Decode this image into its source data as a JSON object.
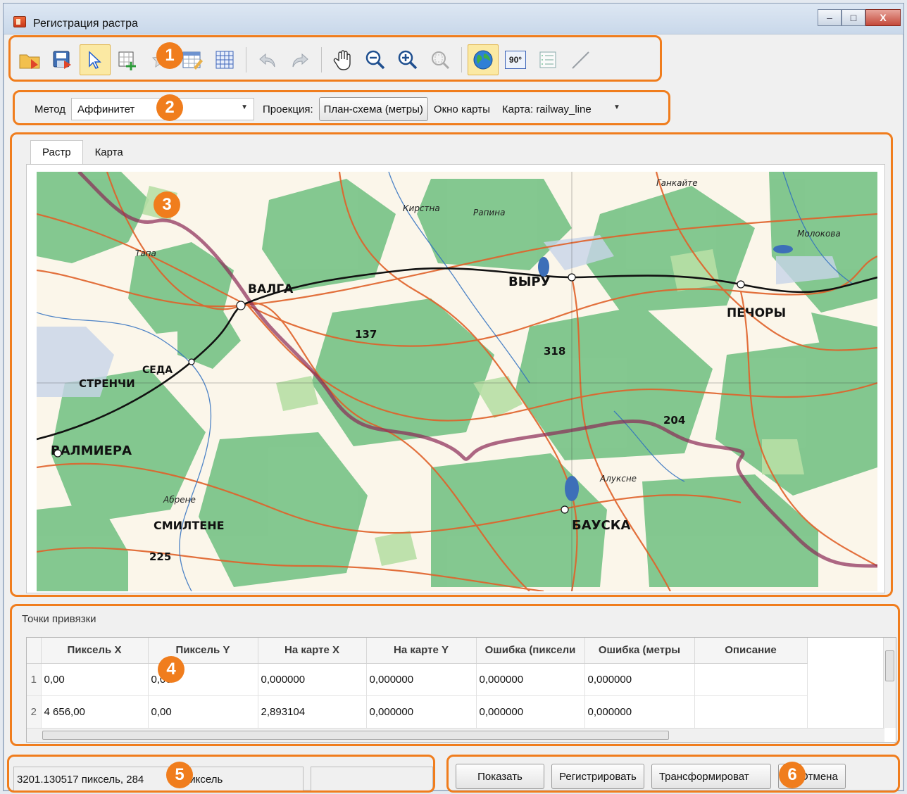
{
  "window": {
    "title": "Регистрация растра",
    "minimize": "‒",
    "maximize": "□",
    "close": "X"
  },
  "toolbar": {
    "items": [
      "open",
      "save",
      "select",
      "add-point",
      "delete-point",
      "table",
      "grid",
      "undo",
      "redo",
      "pan",
      "zoom-out",
      "zoom-in",
      "zoom-extent",
      "globe",
      "rotate-90",
      "list",
      "line"
    ],
    "rotate_label": "90°"
  },
  "params": {
    "method_label": "Метод",
    "method_value": "Аффинитет",
    "projection_label": "Проекция:",
    "projection_value": "План-схема (метры)",
    "map_window_label": "Окно карты",
    "map_window_value": "Карта: railway_line"
  },
  "tabs": [
    {
      "label": "Растр",
      "active": true
    },
    {
      "label": "Карта",
      "active": false
    }
  ],
  "map_labels": [
    "ВАЛГА",
    "ВЫРУ",
    "ПЕЧОРЫ",
    "ВАЛМИЕРА",
    "СМИЛТЕНЕ",
    "БАУСКА",
    "СТРЕНЧИ",
    "СЕДА",
    "Молокова",
    "Абрене",
    "Алуксне",
    "Тапа",
    "Ганкайте",
    "Рапина",
    "Кирстна",
    "318",
    "204",
    "225",
    "137"
  ],
  "points": {
    "title": "Точки привязки",
    "columns": [
      "Пиксель X",
      "Пиксель Y",
      "На карте X",
      "На карте Y",
      "Ошибка (пиксели",
      "Ошибка (метры",
      "Описание"
    ],
    "rows": [
      {
        "n": "1",
        "px": "0,00",
        "py": "0,00",
        "mx": "0,000000",
        "my": "0,000000",
        "ep": "0,000000",
        "em": "0,000000",
        "desc": ""
      },
      {
        "n": "2",
        "px": "4 656,00",
        "py": "0,00",
        "mx": "2,893104",
        "my": "0,000000",
        "ep": "0,000000",
        "em": "0,000000",
        "desc": ""
      }
    ]
  },
  "status": {
    "coords": "3201.130517 пиксель, 284",
    "coords_tail": "96 пиксель",
    "extra": ""
  },
  "actions": {
    "show": "Показать",
    "register": "Регистрировать",
    "transform": "Трансформироват",
    "cancel": "Отмена"
  },
  "badges": [
    "1",
    "2",
    "3",
    "4",
    "5",
    "6"
  ],
  "colors": {
    "accent": "#f07d1d",
    "map_forest": "#6fbf80",
    "map_road": "#e0622a",
    "map_border": "#8a2a55"
  }
}
